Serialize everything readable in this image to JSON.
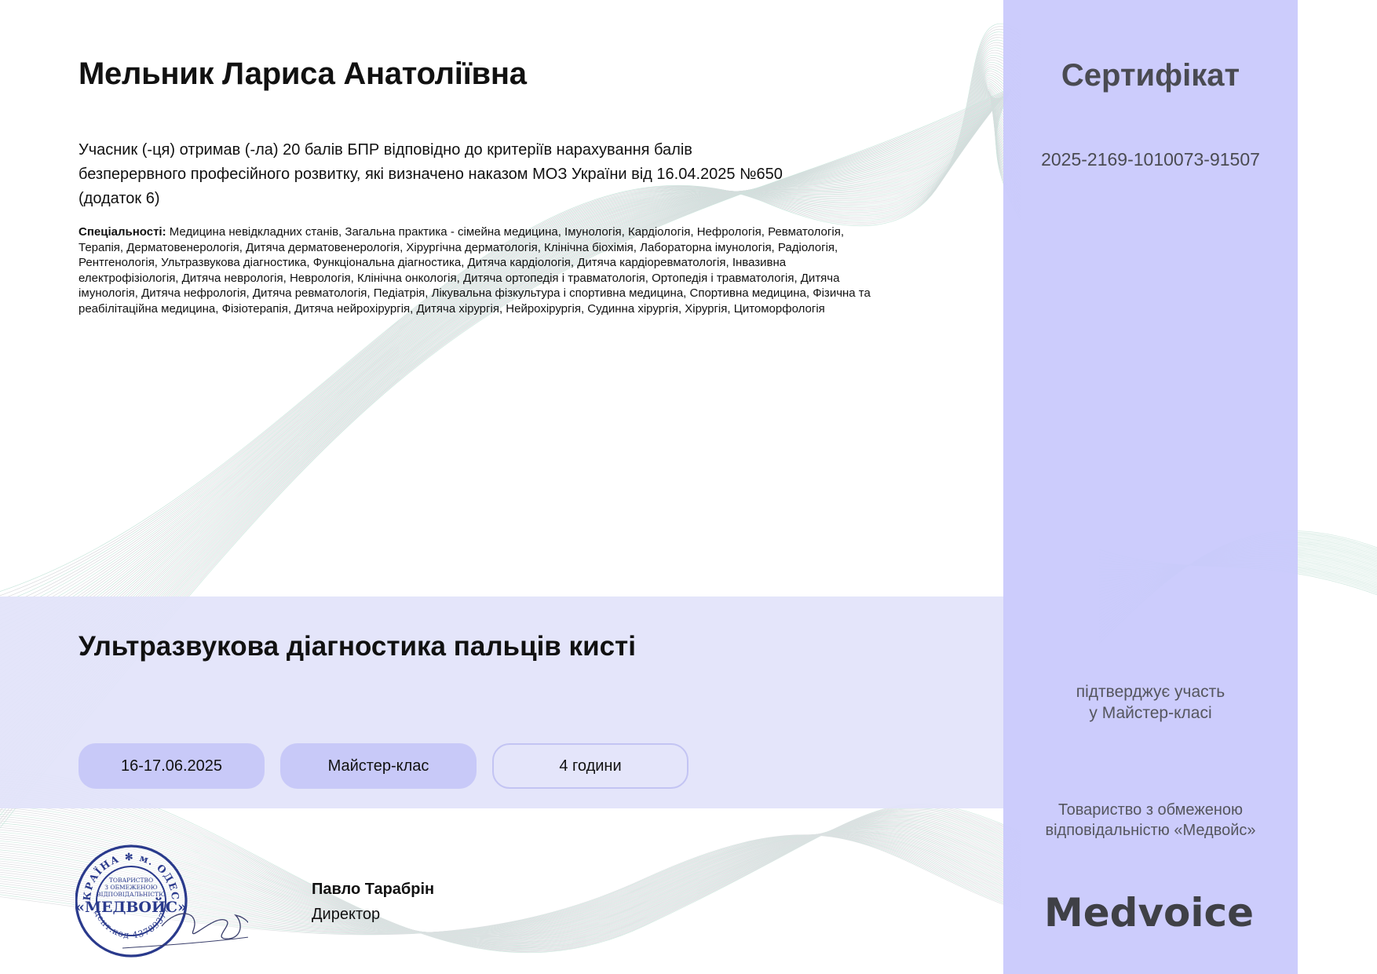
{
  "recipient": {
    "name": "Мельник Лариса Анатоліївна"
  },
  "intro": {
    "line1": "Учасник (-ця) отримав (-ла) 20 балів БПР відповідно до критеріїв нарахування балів",
    "line2": "безперервного професійного розвитку, які визначено наказом МОЗ України від 16.04.2025 №650",
    "line3": "(додаток 6)"
  },
  "specialties": {
    "label": "Спеціальності:",
    "lines": [
      " Медицина невідкладних станів, Загальна практика - сімейна медицина, Імунологія, Кардіологія, Нефрологія, Ревматологія,",
      "Терапія, Дерматовенерологія, Дитяча дерматовенерологія, Хірургічна дерматологія, Клінічна біохімія, Лабораторна імунологія, Радіологія,",
      "Рентгенологія, Ультразвукова діагностика, Функціональна діагностика, Дитяча кардіологія, Дитяча кардіоревматологія, Інвазивна",
      "електрофізіологія, Дитяча неврологія, Неврологія, Клінічна онкологія, Дитяча ортопедія і травматологія, Ортопедія і травматологія, Дитяча",
      "імунологія, Дитяча нефрологія, Дитяча ревматологія, Педіатрія, Лікувальна фізкультура і спортивна медицина, Спортивна медицина, Фізична та",
      "реабілітаційна медицина, Фізіотерапія, Дитяча нейрохірургія, Дитяча хірургія, Нейрохірургія, Судинна хірургія, Хірургія, Цитоморфологія"
    ]
  },
  "course": {
    "title": "Ультразвукова діагностика пальців кисті",
    "date": "16-17.06.2025",
    "type": "Майстер-клас",
    "hours": "4 години"
  },
  "signer": {
    "name": "Павло Тарабрін",
    "role": "Директор"
  },
  "seal": {
    "ring_text": "УКРАЇНА ✻ м. ОДЕСА",
    "line1": "ТОВАРИСТВО",
    "line2": "З ОБМЕЖЕНОЮ",
    "line3": "ВІДПОВІДАЛЬНІСТЮ",
    "brand": "«МЕДВОЙС»",
    "code": "Ідент.код 43789377"
  },
  "sidebar": {
    "title": "Сертифікат",
    "number": "2025-2169-1010073-91507",
    "confirm_line1": "підтверджує участь",
    "confirm_line2": "у Майстер-класі",
    "company_line1": "Товариство з обмеженою",
    "company_line2": "відповідальністю «Медвойс»",
    "logo": "Medvoice."
  },
  "colors": {
    "sidebar": "#c8c8fc",
    "band": "#e2e3fa",
    "pill": "#c8c9f8",
    "seal_ink": "#2a3a8c",
    "logo": "#3f4046"
  }
}
